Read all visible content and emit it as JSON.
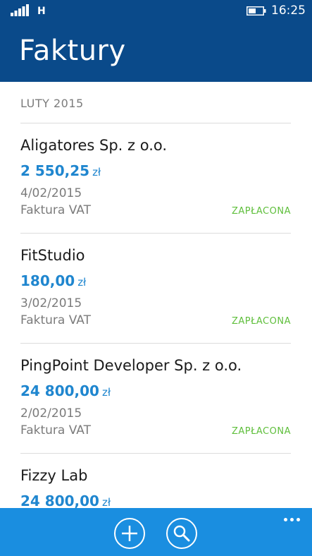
{
  "status_bar": {
    "network": "H",
    "time": "16:25",
    "icons": [
      "signal-icon",
      "battery-icon"
    ]
  },
  "header": {
    "title": "Faktury"
  },
  "list": {
    "section": "LUTY 2015",
    "invoices": [
      {
        "name": "Aligatores Sp. z o.o.",
        "amount": "2 550,25",
        "currency": "zł",
        "date": "4/02/2015",
        "type": "Faktura VAT",
        "status": "ZAPŁACONA"
      },
      {
        "name": "FitStudio",
        "amount": "180,00",
        "currency": "zł",
        "date": "3/02/2015",
        "type": "Faktura VAT",
        "status": "ZAPŁACONA"
      },
      {
        "name": "PingPoint Developer Sp. z o.o.",
        "amount": "24 800,00",
        "currency": "zł",
        "date": "2/02/2015",
        "type": "Faktura VAT",
        "status": "ZAPŁACONA"
      },
      {
        "name": "Fizzy Lab",
        "amount": "24 800,00",
        "currency": "zł"
      }
    ]
  },
  "app_bar": {
    "icons": [
      "add-icon",
      "search-icon",
      "more-icon"
    ]
  },
  "colors": {
    "header_bg": "#0a4a8a",
    "amount": "#1f86cf",
    "status_paid": "#5fbf3c",
    "app_bar_bg": "#1a8ee0"
  }
}
